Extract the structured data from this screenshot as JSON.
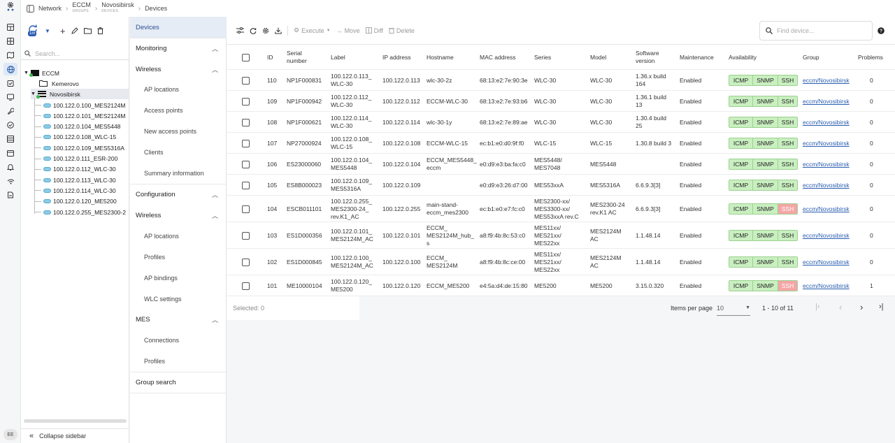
{
  "breadcrumb": {
    "root": "Network",
    "groups": {
      "name": "ECCM",
      "caption": "GROUPS"
    },
    "devices": {
      "name": "Novosibirsk",
      "caption": "DEVICES"
    },
    "current": "Devices"
  },
  "rail": {
    "icons": [
      "app-logo-icon",
      "dashboard-icon",
      "grid-icon",
      "map-icon",
      "globe-icon",
      "clipboard-icon",
      "monitor-icon",
      "wrench-icon",
      "check-circle-icon",
      "table-icon",
      "calendar-icon",
      "bell-icon",
      "signal-icon",
      "database-icon",
      "settings-icon"
    ],
    "avatar": "EE"
  },
  "tree": {
    "search_placeholder": "Search...",
    "badge": "1m",
    "root": "ECCM",
    "nodes": [
      {
        "label": "Kemerovo",
        "type": "folder"
      },
      {
        "label": "Novosibirsk",
        "type": "group"
      }
    ],
    "devices": [
      "100.122.0.100_MES2124M",
      "100.122.0.101_MES2124M",
      "100.122.0.104_MES5448",
      "100.122.0.108_WLC-15",
      "100.122.0.109_MES5316A",
      "100.122.0.111_ESR-200",
      "100.122.0.112_WLC-30",
      "100.122.0.113_WLC-30",
      "100.122.0.114_WLC-30",
      "100.122.0.120_ME5200",
      "100.122.0.255_MES2300-2"
    ],
    "collapse_label": "Collapse sidebar"
  },
  "menu": {
    "devices": "Devices",
    "monitoring": "Monitoring",
    "wireless": "Wireless",
    "monitoring_items": [
      "AP locations",
      "Access points",
      "New access points",
      "Clients",
      "Summary information"
    ],
    "configuration": "Configuration",
    "config_wireless": "Wireless",
    "config_items": [
      "AP locations",
      "Profiles",
      "AP bindings",
      "WLC settings"
    ],
    "mes": "MES",
    "mes_items": [
      "Connections",
      "Profiles"
    ],
    "group_search": "Group search"
  },
  "toolbar": {
    "execute": "Execute",
    "move": "Move",
    "diff": "Diff",
    "delete": "Delete",
    "search_placeholder": "Find device..."
  },
  "table": {
    "headers": {
      "id": "ID",
      "serial": [
        "Serial",
        "number"
      ],
      "label": "Label",
      "ip": "IP address",
      "hostname": "Hostname",
      "mac": "MAC address",
      "series": "Series",
      "model": "Model",
      "software": [
        "Software",
        "version"
      ],
      "maintenance": "Maintenance",
      "availability": "Availability",
      "group": "Group",
      "problems": "Problems"
    },
    "rows": [
      {
        "id": "110",
        "serial": "NP1F000831",
        "label": [
          "100.122.0.113_",
          "WLC-30"
        ],
        "ip": "100.122.0.113",
        "hostname": [
          "wlc-30-2z"
        ],
        "mac": "68:13:e2:7e:90:3e",
        "series": [
          "WLC-30"
        ],
        "model": [
          "WLC-30"
        ],
        "sw": [
          "1.36.x build",
          "164"
        ],
        "maint": "Enabled",
        "icmp": "ICMP",
        "snmp": "SNMP",
        "ssh": "SSH",
        "ssh_ok": true,
        "group": "eccm/Novosibirsk",
        "problems": "0"
      },
      {
        "id": "109",
        "serial": "NP1F000942",
        "label": [
          "100.122.0.112_",
          "WLC-30"
        ],
        "ip": "100.122.0.112",
        "hostname": [
          "ECCM-WLC-30"
        ],
        "mac": "68:13:e2:7e:93:b6",
        "series": [
          "WLC-30"
        ],
        "model": [
          "WLC-30"
        ],
        "sw": [
          "1.36.1 build",
          "13"
        ],
        "maint": "Enabled",
        "icmp": "ICMP",
        "snmp": "SNMP",
        "ssh": "SSH",
        "ssh_ok": true,
        "group": "eccm/Novosibirsk",
        "problems": "0"
      },
      {
        "id": "108",
        "serial": "NP1F000621",
        "label": [
          "100.122.0.114_",
          "WLC-30"
        ],
        "ip": "100.122.0.114",
        "hostname": [
          "wlc-30-1y"
        ],
        "mac": "68:13:e2:7e:89:ae",
        "series": [
          "WLC-30"
        ],
        "model": [
          "WLC-30"
        ],
        "sw": [
          "1.30.4 build",
          "25"
        ],
        "maint": "Enabled",
        "icmp": "ICMP",
        "snmp": "SNMP",
        "ssh": "SSH",
        "ssh_ok": true,
        "group": "eccm/Novosibirsk",
        "problems": "0"
      },
      {
        "id": "107",
        "serial": "NP27000924",
        "label": [
          "100.122.0.108_",
          "WLC-15"
        ],
        "ip": "100.122.0.108",
        "hostname": [
          "ECCM-WLC-15"
        ],
        "mac": "ec:b1:e0:d0:9f:f0",
        "series": [
          "WLC-15"
        ],
        "model": [
          "WLC-15"
        ],
        "sw": [
          "1.30.8 build 3"
        ],
        "maint": "Enabled",
        "icmp": "ICMP",
        "snmp": "SNMP",
        "ssh": "SSH",
        "ssh_ok": true,
        "group": "eccm/Novosibirsk",
        "problems": "0"
      },
      {
        "id": "106",
        "serial": "ES23000060",
        "label": [
          "100.122.0.104_",
          "MES5448"
        ],
        "ip": "100.122.0.104",
        "hostname": [
          "ECCM_MES5448_",
          "eccm"
        ],
        "mac": "e0:d9:e3:ba:fa:c0",
        "series": [
          "MES5448/",
          "MES7048"
        ],
        "model": [
          "MES5448"
        ],
        "sw": [],
        "maint": "Enabled",
        "icmp": "ICMP",
        "snmp": "SNMP",
        "ssh": "SSH",
        "ssh_ok": true,
        "group": "eccm/Novosibirsk",
        "problems": "0"
      },
      {
        "id": "105",
        "serial": "ES8B000023",
        "label": [
          "100.122.0.109_",
          "MES5316A"
        ],
        "ip": "100.122.0.109",
        "hostname": [],
        "mac": "e0:d9:e3:26:d7:00",
        "series": [
          "MES53xxA"
        ],
        "model": [
          "MES5316A"
        ],
        "sw": [
          "6.6.9.3[3]"
        ],
        "maint": "Enabled",
        "icmp": "ICMP",
        "snmp": "SNMP",
        "ssh": "SSH",
        "ssh_ok": true,
        "group": "eccm/Novosibirsk",
        "problems": "0"
      },
      {
        "id": "104",
        "serial": "ESCB011101",
        "label": [
          "100.122.0.255_",
          "MES2300-24_",
          "rev.K1_AC"
        ],
        "ip": "100.122.0.255",
        "hostname": [
          "main-stand-",
          "eccm_mes2300"
        ],
        "mac": "ec:b1:e0:e7:fc:c0",
        "series": [
          "MES2300-xx/",
          "MES3300-xx/",
          "MES53xxA rev.C"
        ],
        "model": [
          "MES2300-24",
          "rev.K1 AC"
        ],
        "sw": [
          "6.6.9.3[3]"
        ],
        "maint": "Enabled",
        "icmp": "ICMP",
        "snmp": "SNMP",
        "ssh": "SSH",
        "ssh_ok": false,
        "group": "eccm/Novosibirsk",
        "problems": "0"
      },
      {
        "id": "103",
        "serial": "ES1D000356",
        "label": [
          "100.122.0.101_",
          "MES2124M_AC"
        ],
        "ip": "100.122.0.101",
        "hostname": [
          "ECCM_",
          "MES2124M_hub_",
          "s"
        ],
        "mac": "a8:f9:4b:8c:53:c0",
        "series": [
          "MES11xx/",
          "MES21xx/",
          "MES22xx"
        ],
        "model": [
          "MES2124M",
          "AC"
        ],
        "sw": [
          "1.1.48.14"
        ],
        "maint": "Enabled",
        "icmp": "ICMP",
        "snmp": "SNMP",
        "ssh": "SSH",
        "ssh_ok": true,
        "group": "eccm/Novosibirsk",
        "problems": "0"
      },
      {
        "id": "102",
        "serial": "ES1D000845",
        "label": [
          "100.122.0.100_",
          "MES2124M_AC"
        ],
        "ip": "100.122.0.100",
        "hostname": [
          "ECCM_",
          "MES2124M"
        ],
        "mac": "a8:f9:4b:8c:ce:00",
        "series": [
          "MES11xx/",
          "MES21xx/",
          "MES22xx"
        ],
        "model": [
          "MES2124M",
          "AC"
        ],
        "sw": [
          "1.1.48.14"
        ],
        "maint": "Enabled",
        "icmp": "ICMP",
        "snmp": "SNMP",
        "ssh": "SSH",
        "ssh_ok": true,
        "group": "eccm/Novosibirsk",
        "problems": "0"
      },
      {
        "id": "101",
        "serial": "ME10000104",
        "label": [
          "100.122.0.120_",
          "ME5200"
        ],
        "ip": "100.122.0.120",
        "hostname": [
          "ECCM_ME5200"
        ],
        "mac": "e4:5a:d4:de:15:80",
        "series": [
          "ME5200"
        ],
        "model": [
          "ME5200"
        ],
        "sw": [
          "3.15.0.320"
        ],
        "maint": "Enabled",
        "icmp": "ICMP",
        "snmp": "SNMP",
        "ssh": "SSH",
        "ssh_ok": false,
        "group": "eccm/Novosibirsk",
        "problems": "1"
      }
    ]
  },
  "footer": {
    "selected": "Selected: 0",
    "items_per_page_label": "Items per page",
    "items_per_page": "10",
    "range": "1 - 10 of 11"
  },
  "colors": {
    "ok": "#c9efc0",
    "bad": "#f4a6a6",
    "link": "#2a5db0",
    "active_menu": "#e6ecf6"
  }
}
